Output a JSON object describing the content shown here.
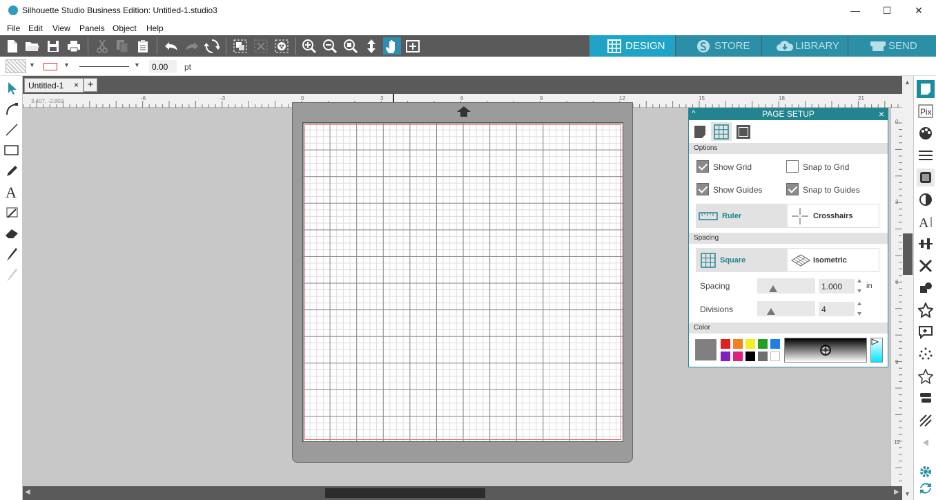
{
  "window": {
    "title": "Silhouette Studio Business Edition: Untitled-1.studio3",
    "minimize": "—",
    "maximize": "☐",
    "close": "✕"
  },
  "menu": [
    "File",
    "Edit",
    "View",
    "Panels",
    "Object",
    "Help"
  ],
  "toolbar": {
    "icons": [
      "new-document-icon",
      "open-folder-icon",
      "save-icon",
      "print-icon",
      "cut-icon",
      "copy-icon",
      "paste-icon",
      "undo-icon",
      "redo-icon",
      "rotate-icon",
      "group-icon",
      "ungroup-icon",
      "compound-path-icon",
      "zoom-in-icon",
      "zoom-out-icon",
      "zoom-fit-icon",
      "move-icon",
      "pan-hand-icon",
      "fit-page-icon"
    ],
    "nav_tabs": [
      {
        "label": "DESIGN",
        "active": true
      },
      {
        "label": "STORE",
        "active": false
      },
      {
        "label": "LIBRARY",
        "active": false
      },
      {
        "label": "SEND",
        "active": false
      }
    ],
    "active_color": "#1fa4c7",
    "inactive_color": "#2c8fa8"
  },
  "properties": {
    "line_width": "0.00",
    "unit": "pt"
  },
  "document": {
    "tab_label": "Untitled-1",
    "tab_close": "×",
    "add_tab": "+"
  },
  "ruler": {
    "coords": "3.407, -2.802",
    "h_ticks": [
      "-6",
      "-3",
      "0",
      "3",
      "6",
      "9",
      "12",
      "15",
      "18",
      "21"
    ],
    "v_ticks": [
      "0",
      "3",
      "6",
      "9",
      "12"
    ]
  },
  "page_setup": {
    "title": "PAGE SETUP",
    "close": "×",
    "collapse": "^",
    "options_label": "Options",
    "show_grid": {
      "label": "Show Grid",
      "checked": true
    },
    "snap_to_grid": {
      "label": "Snap to Grid",
      "checked": false
    },
    "show_guides": {
      "label": "Show Guides",
      "checked": true
    },
    "snap_to_guides": {
      "label": "Snap to Guides",
      "checked": true
    },
    "ruler_btn": "Ruler",
    "crosshairs_btn": "Crosshairs",
    "spacing_section": "Spacing",
    "square_btn": "Square",
    "isometric_btn": "Isometric",
    "spacing_label": "Spacing",
    "spacing_value": "1.000",
    "spacing_unit": "in",
    "divisions_label": "Divisions",
    "divisions_value": "4",
    "color_section": "Color",
    "current_color": "#808080",
    "swatches": [
      "#e02020",
      "#f08020",
      "#f0f020",
      "#20a020",
      "#2080e0",
      "#8020c0",
      "#e02080",
      "#000000",
      "#707070",
      "#ffffff"
    ]
  }
}
